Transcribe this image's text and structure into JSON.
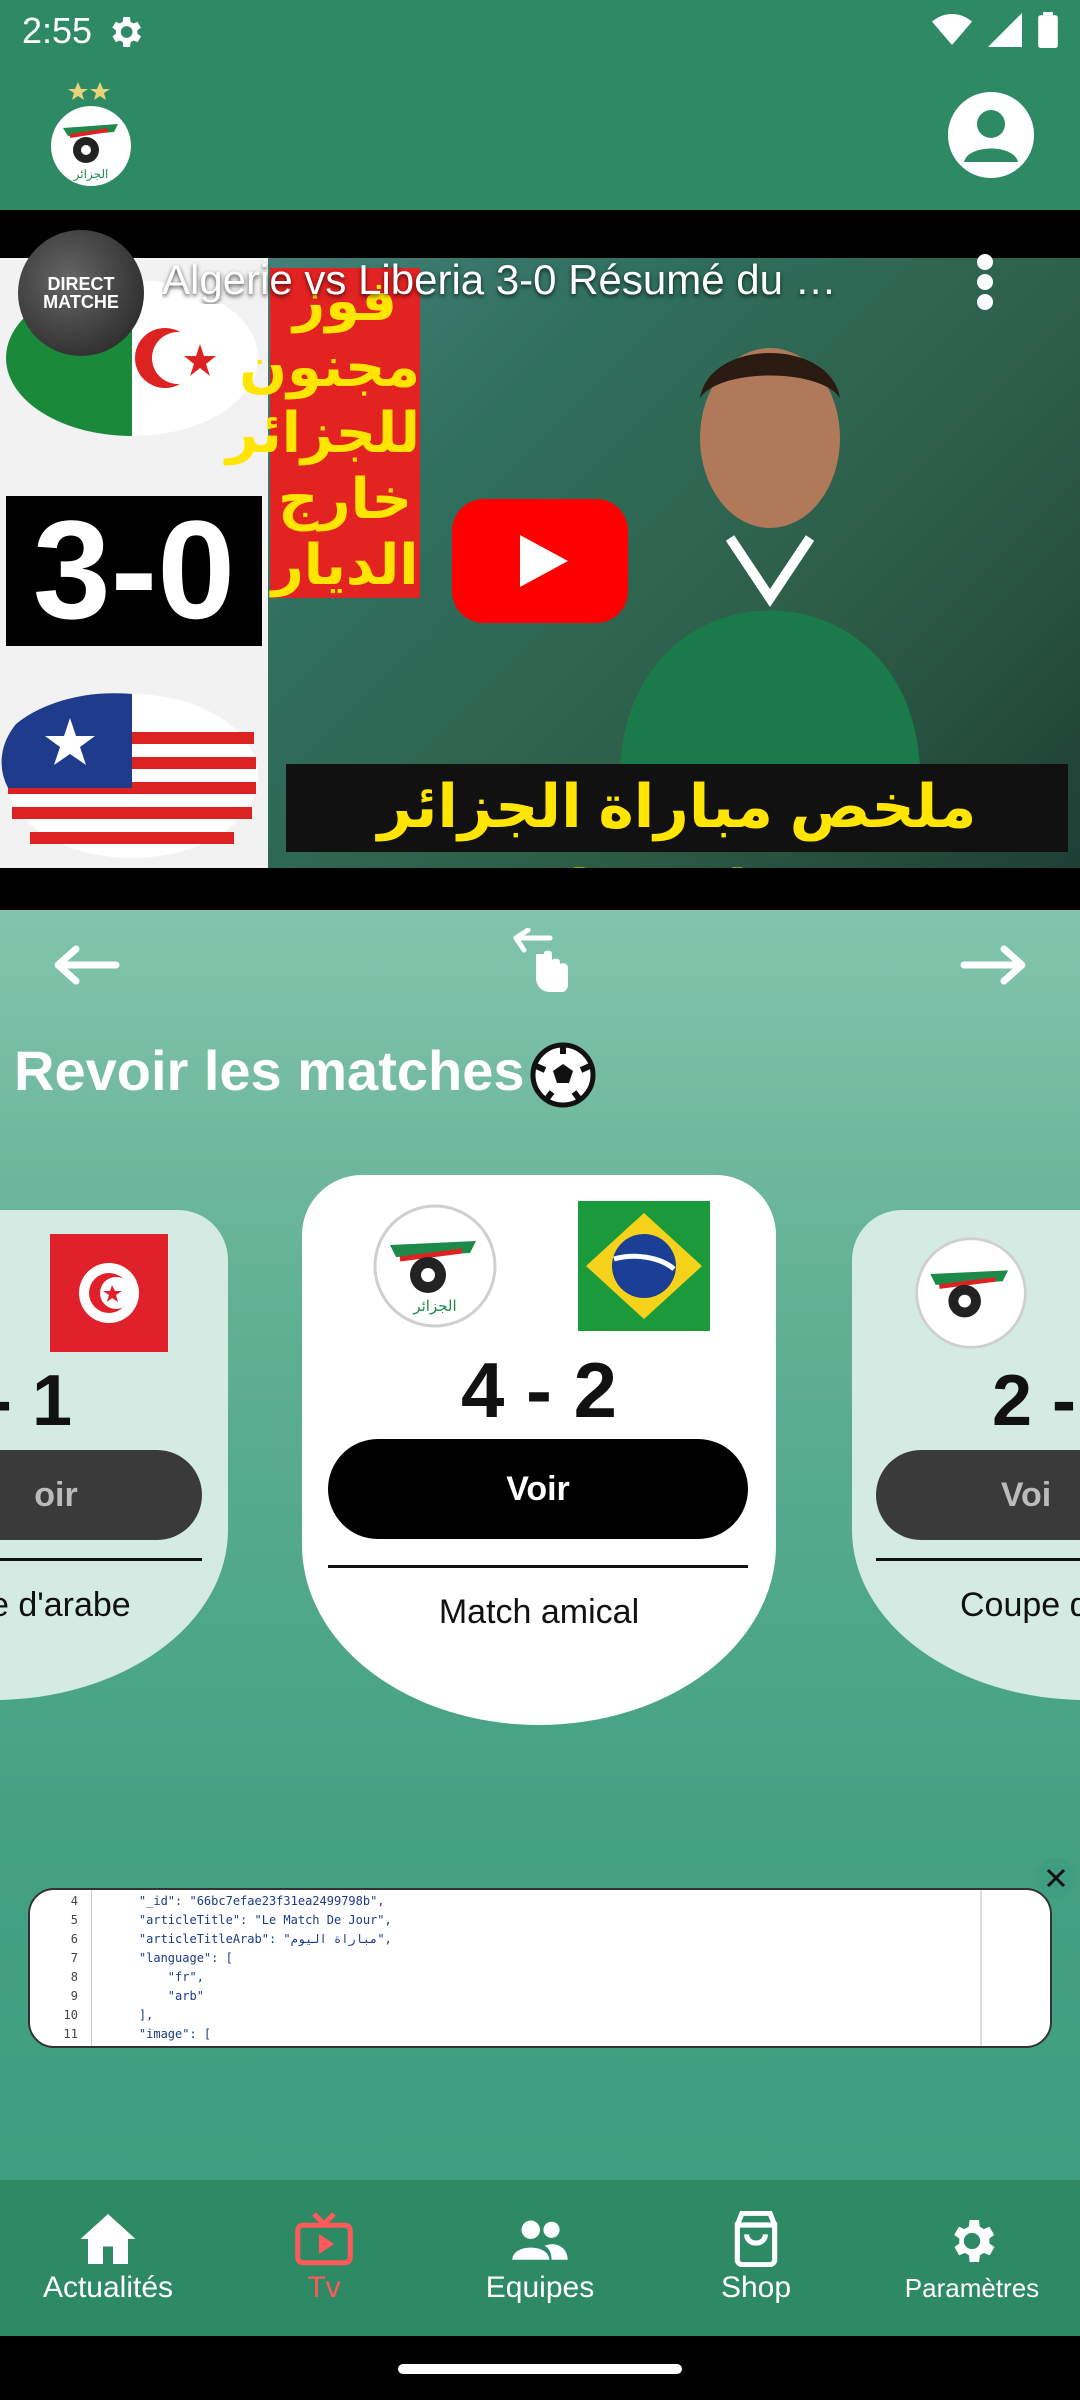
{
  "status_bar": {
    "time": "2:55"
  },
  "video": {
    "title": "Algerie vs Liberia 3-0 Résumé du …",
    "score_badge": "3-0",
    "channel_label": "DIRECT MATCHE",
    "red_panel_text": "فوز مجنون للجزائر خارج الديار",
    "caption_ar": "ملخص مباراة الجزائر وليبيريا"
  },
  "section": {
    "title": "Revoir les matches"
  },
  "cards": {
    "left": {
      "score": "- 1",
      "button": "oir",
      "competition": "e d'arabe"
    },
    "center": {
      "score": "4 - 2",
      "button": "Voir",
      "competition": "Match amical",
      "home_team": "الجزائر"
    },
    "right": {
      "score": "2 -",
      "button": "Voi",
      "competition": "Coupe d"
    }
  },
  "code_banner": {
    "lines": [
      {
        "n": "4",
        "text": "    \"_id\": \"66bc7efae23f31ea2499798b\","
      },
      {
        "n": "5",
        "text": "    \"articleTitle\": \"Le Match De Jour\","
      },
      {
        "n": "6",
        "text": "    \"articleTitleArab\": \"مباراة اليوم\","
      },
      {
        "n": "7",
        "text": "    \"language\": ["
      },
      {
        "n": "8",
        "text": "        \"fr\","
      },
      {
        "n": "9",
        "text": "        \"arb\""
      },
      {
        "n": "10",
        "text": "    ],"
      },
      {
        "n": "11",
        "text": "    \"image\": ["
      }
    ]
  },
  "bottom_nav": {
    "items": [
      {
        "label": "Actualités",
        "icon": "home-icon"
      },
      {
        "label": "Tv",
        "icon": "tv-icon"
      },
      {
        "label": "Equipes",
        "icon": "people-icon"
      },
      {
        "label": "Shop",
        "icon": "bag-icon"
      },
      {
        "label": "Paramètres",
        "icon": "gear-icon"
      }
    ],
    "active": "Tv"
  },
  "colors": {
    "header": "#2e8a64",
    "accent_active": "#ff5a5a",
    "card": "#ffffff",
    "card_side": "#d3ebe3"
  }
}
